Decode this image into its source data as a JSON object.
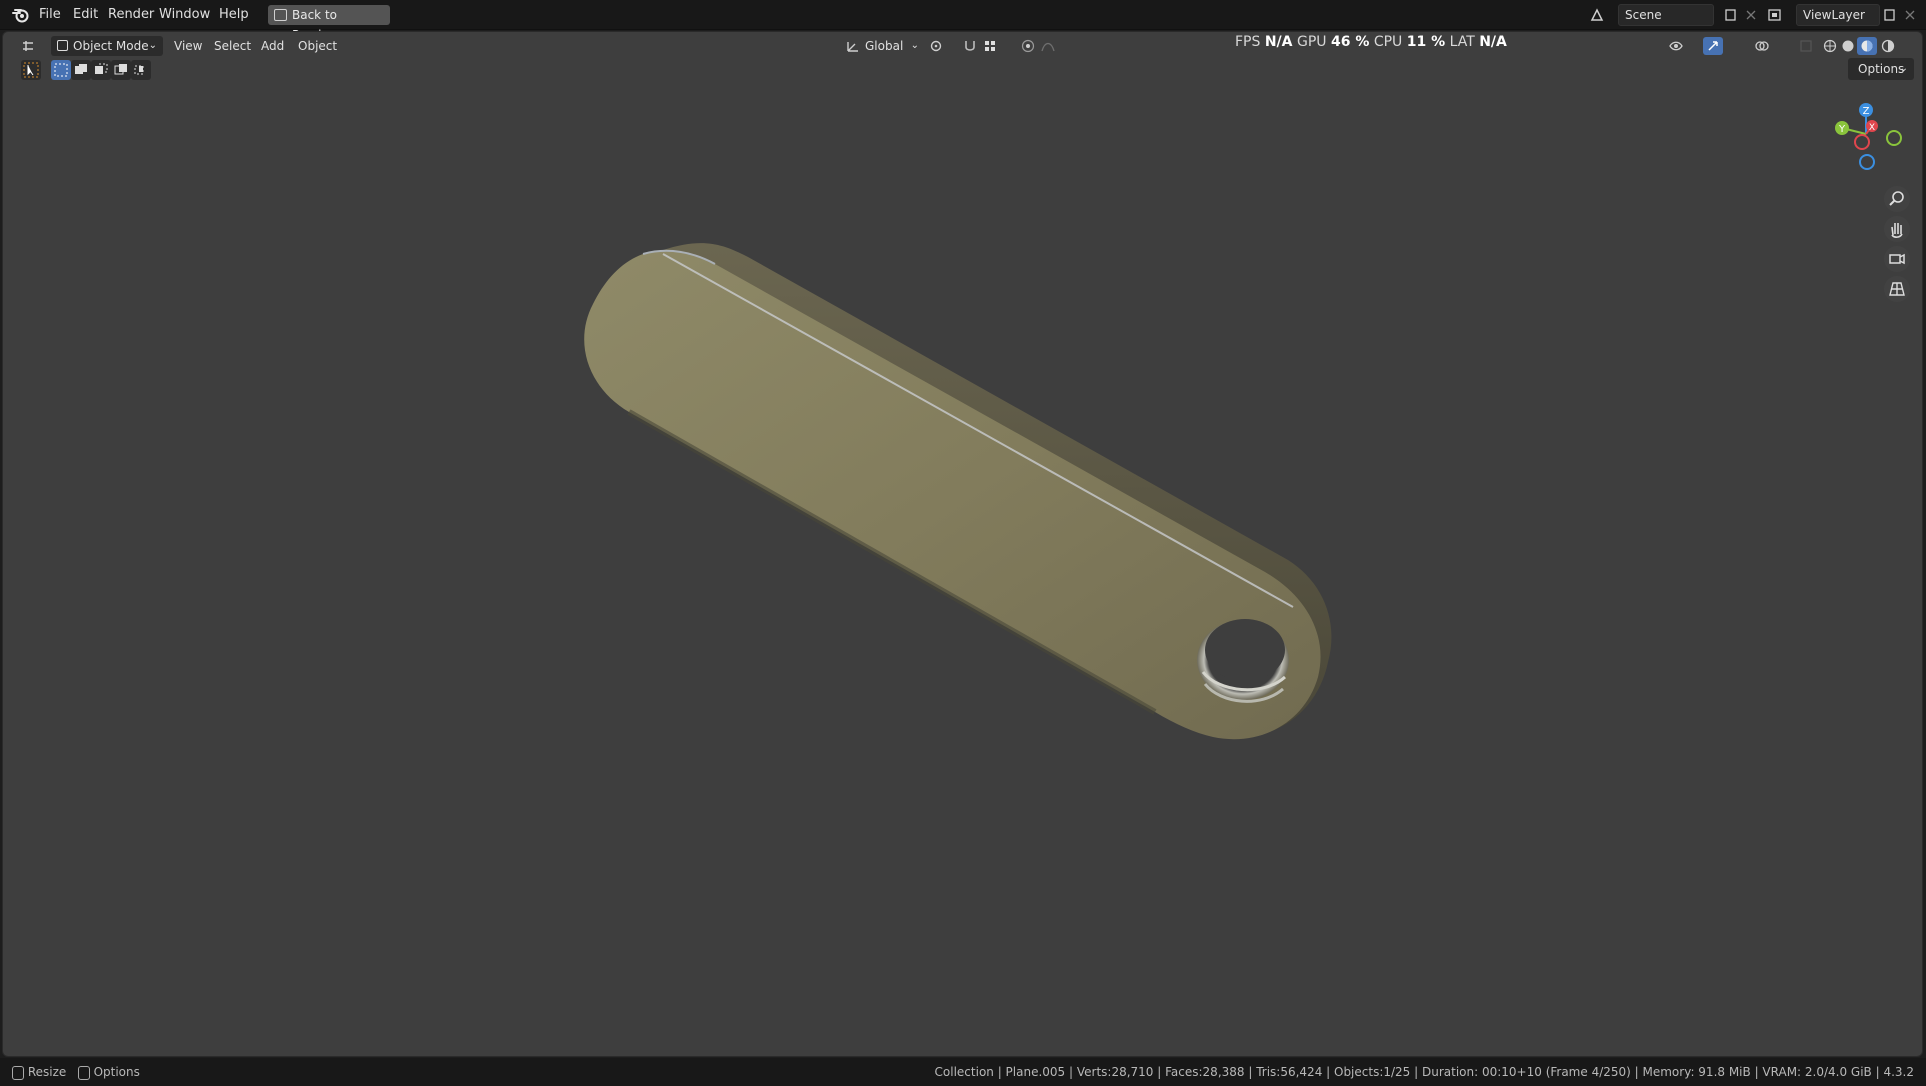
{
  "menu": {
    "file": "File",
    "edit": "Edit",
    "render": "Render",
    "window": "Window",
    "help": "Help",
    "back_to_previous": "Back to Previous"
  },
  "top_right": {
    "scene": "Scene",
    "view_layer": "ViewLayer"
  },
  "viewport_header": {
    "mode": "Object Mode",
    "view": "View",
    "select": "Select",
    "add": "Add",
    "object": "Object",
    "orientation": "Global",
    "options": "Options"
  },
  "stats": {
    "fps_label": "FPS",
    "fps_value": "N/A",
    "gpu_label": "GPU",
    "gpu_value": "46 %",
    "cpu_label": "CPU",
    "cpu_value": "11 %",
    "lat_label": "LAT",
    "lat_value": "N/A"
  },
  "gizmo": {
    "z": "Z",
    "y": "Y",
    "x": "X"
  },
  "statusbar": {
    "resize": "Resize",
    "options": "Options",
    "info": "Collection | Plane.005 | Verts:28,710 | Faces:28,388 | Tris:56,424 | Objects:1/25 | Duration: 00:10+10 (Frame 4/250) | Memory: 91.8 MiB | VRAM: 2.0/4.0 GiB | 4.3.2"
  },
  "colors": {
    "viewport_bg": "#3e3e3e",
    "object_top": "#8a8460",
    "object_side": "#5e5a45",
    "accent_blue": "#4772b3",
    "axis_x": "#e0464d",
    "axis_y": "#8ac43c",
    "axis_z": "#3b8fe0"
  }
}
